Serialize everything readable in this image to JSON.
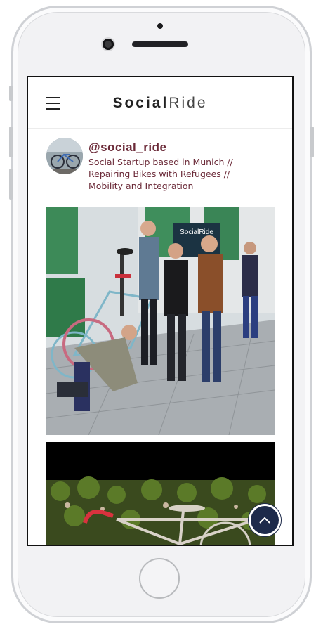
{
  "header": {
    "menu_icon": "hamburger-menu-icon",
    "brand_part1": "Social",
    "brand_part2": "Ride"
  },
  "profile": {
    "handle": "@social_ride",
    "bio_lines": [
      "Social Startup based in Munich //",
      "Repairing Bikes with Refugees //",
      "Mobility and Integration"
    ]
  },
  "posts": [
    {
      "sign_text": "SocialRide"
    },
    {}
  ],
  "scroll_top_icon": "chevron-up-icon",
  "colors": {
    "accent": "#6b2a38",
    "fab": "#1d2a4a"
  }
}
